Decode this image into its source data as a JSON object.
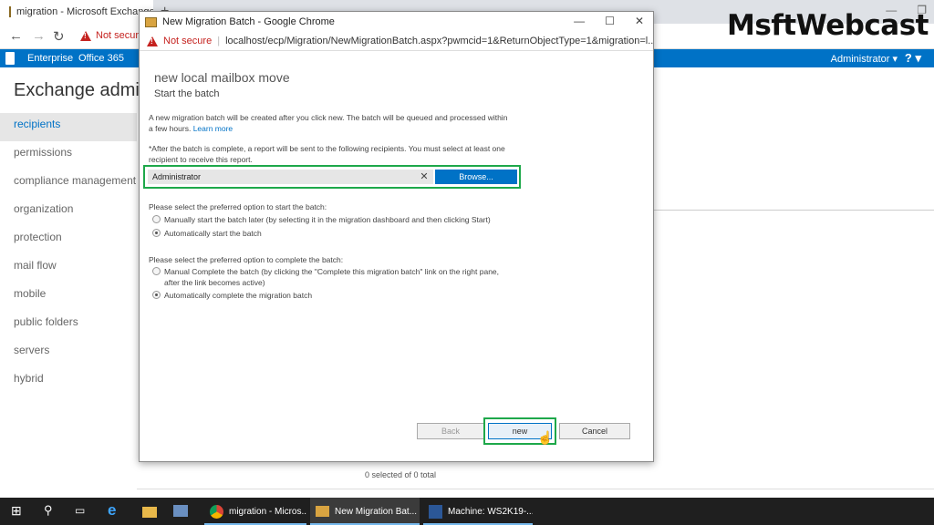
{
  "background_window": {
    "tab_title": "migration - Microsoft Exchange",
    "not_secure": "Not secure",
    "nav": {
      "enterprise": "Enterprise",
      "office365": "Office 365",
      "admin": "Administrator ▾",
      "help": "? ▾"
    },
    "app_title": "Exchange admin ce",
    "left_nav": [
      "recipients",
      "permissions",
      "compliance management",
      "organization",
      "protection",
      "mail flow",
      "mobile",
      "public folders",
      "servers",
      "hybrid"
    ],
    "status": "0 selected of 0 total"
  },
  "watermark": "MsftWebcast",
  "popup": {
    "window_title": "New Migration Batch - Google Chrome",
    "not_secure": "Not secure",
    "url": "localhost/ecp/Migration/NewMigrationBatch.aspx?pwmcid=1&ReturnObjectType=1&migration=l...",
    "dialog_title": "new local mailbox move",
    "dialog_subtitle": "Start the batch",
    "intro": "A new migration batch will be created after you click new. The batch will be queued and processed within a few hours.",
    "learn_more": "Learn more",
    "recipients_note": "*After the batch is complete, a report will be sent to the following recipients. You must select at least one recipient to receive this report.",
    "recipient_value": "Administrator",
    "browse_label": "Browse...",
    "start_prompt": "Please select the preferred option to start the batch:",
    "start_options": [
      {
        "label": "Manually start the batch later (by selecting it in the migration dashboard and then clicking Start)",
        "selected": false
      },
      {
        "label": "Automatically start the batch",
        "selected": true
      }
    ],
    "complete_prompt": "Please select the preferred option to complete the batch:",
    "complete_options": [
      {
        "label": "Manual Complete the batch (by clicking the \"Complete this migration batch\" link on the right pane, after the link becomes active)",
        "selected": false
      },
      {
        "label": "Automatically complete the migration batch",
        "selected": true
      }
    ],
    "buttons": {
      "back": "Back",
      "new": "new",
      "cancel": "Cancel"
    }
  },
  "taskbar": {
    "apps": [
      {
        "label": "migration - Micros...",
        "active": false
      },
      {
        "label": "New Migration Bat...",
        "active": true
      },
      {
        "label": "Machine: WS2K19-...",
        "active": false
      }
    ]
  },
  "colors": {
    "accent": "#0072c6",
    "highlight": "#1ea84a",
    "warning": "#c5221f"
  }
}
